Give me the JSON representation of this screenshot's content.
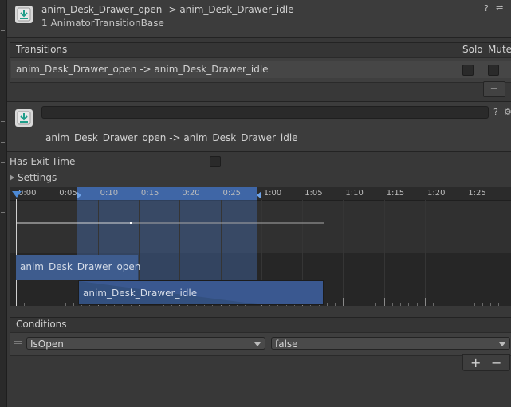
{
  "inspector_header": {
    "title": "anim_Desk_Drawer_open -> anim_Desk_Drawer_idle",
    "subtitle": "1 AnimatorTransitionBase",
    "help_icon": "?",
    "settings_icon": "⇌"
  },
  "transitions": {
    "header_label": "Transitions",
    "solo_label": "Solo",
    "mute_label": "Mute",
    "items": [
      {
        "label": "anim_Desk_Drawer_open -> anim_Desk_Drawer_idle",
        "solo": false,
        "mute": false
      }
    ],
    "remove_label": "−"
  },
  "transition_detail": {
    "name_value": "",
    "label": "anim_Desk_Drawer_open -> anim_Desk_Drawer_idle",
    "help_icon": "?",
    "gear_icon": "⚙"
  },
  "has_exit_time": {
    "label": "Has Exit Time",
    "checked": false
  },
  "settings": {
    "label": "Settings"
  },
  "timeline": {
    "labels": [
      "0:00",
      "0:05",
      "0:10",
      "0:15",
      "0:20",
      "0:25",
      "1:00",
      "1:05",
      "1:10",
      "1:15",
      "1:20",
      "1:25"
    ],
    "clips": [
      {
        "name": "anim_Desk_Drawer_open"
      },
      {
        "name": "anim_Desk_Drawer_idle"
      }
    ]
  },
  "conditions": {
    "header_label": "Conditions",
    "items": [
      {
        "parameter": "IsOpen",
        "value": "false"
      }
    ],
    "add_label": "+",
    "remove_label": "−"
  },
  "colors": {
    "selection": "#446eb0",
    "clip": "#3e5c8e",
    "background": "#383838"
  }
}
